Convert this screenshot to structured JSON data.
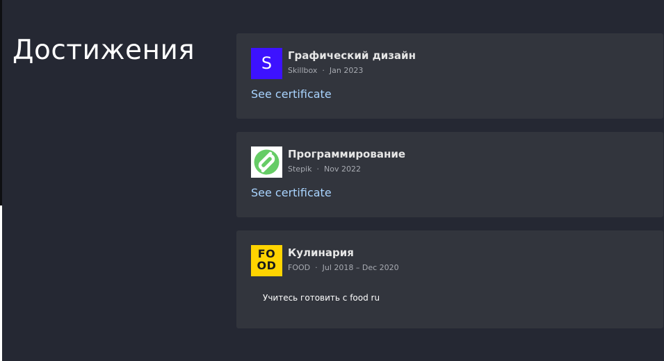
{
  "section": {
    "title": "Достижения"
  },
  "achievements": [
    {
      "title": "Графический дизайн",
      "issuer": "Skillbox",
      "date": "Jan 2023",
      "logo_letter": "S",
      "logo_icon": "skillbox-logo",
      "logo_color": "#3d12ff",
      "link_label": "See certificate"
    },
    {
      "title": "Программирование",
      "issuer": "Stepik",
      "date": "Nov 2022",
      "logo_icon": "stepik-logo",
      "logo_color": "#66cc66",
      "link_label": "See certificate"
    },
    {
      "title": "Кулинария",
      "issuer": "FOOD",
      "date": "Jul 2018 – Dec 2020",
      "logo_text_top": "FO",
      "logo_text_bottom": "OD",
      "logo_icon": "food-logo",
      "logo_color": "#ffd400",
      "description": "Учитесь готовить с food ru"
    }
  ],
  "colors": {
    "background": "#252833",
    "card": "#32353d",
    "link": "#a9d4ff",
    "meta": "#a8abb2"
  },
  "meta_separator": "·"
}
